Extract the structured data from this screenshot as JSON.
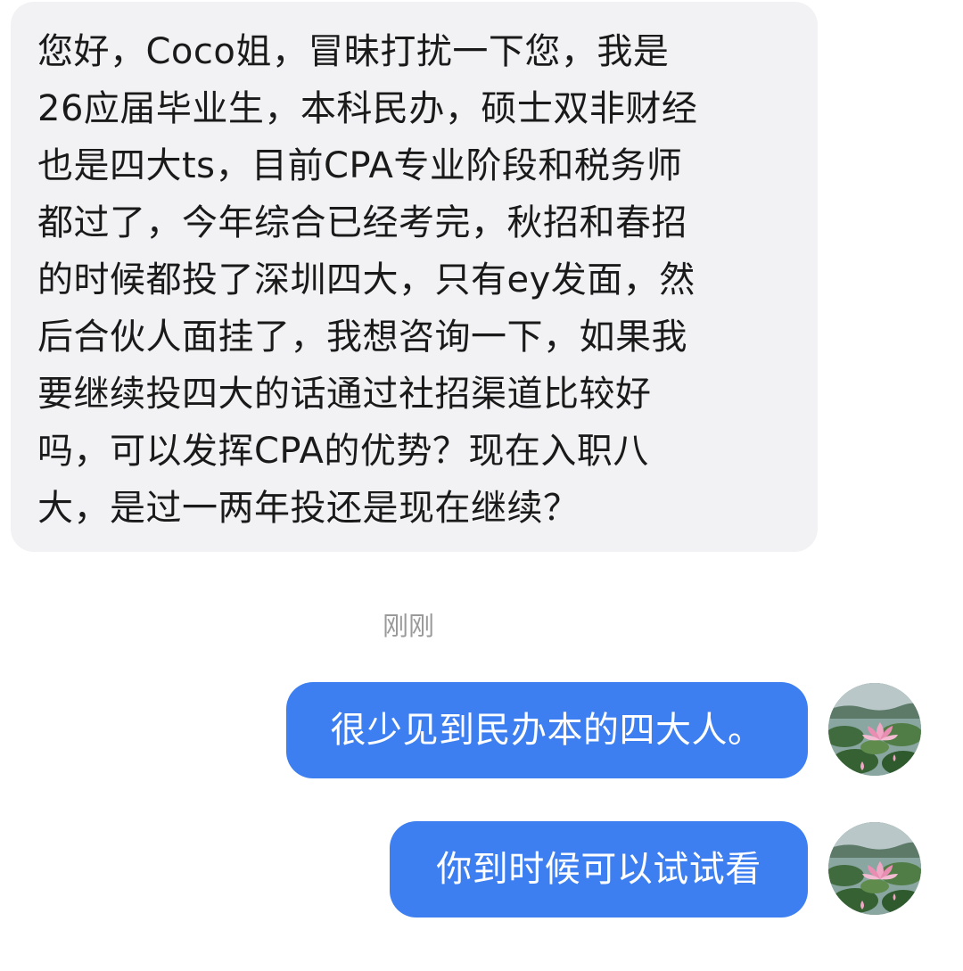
{
  "conversation": {
    "incoming_message": {
      "lines": [
        "您好，Coco姐，冒昧打扰一下您，我是",
        " 26应届毕业生，本科民办，硕士双非财经",
        "也是四大ts，目前CPA专业阶段和税务师",
        "都过了，今年综合已经考完，秋招和春招",
        "的时候都投了深圳四大，只有ey发面，然",
        "后合伙人面挂了，我想咨询一下，如果我",
        "要继续投四大的话通过社招渠道比较好",
        "吗，可以发挥CPA的优势？现在入职八",
        "大，是过一两年投还是现在继续？"
      ]
    },
    "timestamp": "刚刚",
    "outgoing_messages": [
      {
        "text": "很少见到民办本的四大人。",
        "avatar_icon": "lotus-avatar-icon"
      },
      {
        "text": "你到时候可以试试看",
        "avatar_icon": "lotus-avatar-icon"
      }
    ]
  },
  "colors": {
    "incoming_bubble": "#f2f2f4",
    "outgoing_bubble": "#3d7ff0",
    "timestamp_text": "#9a9a9a"
  }
}
